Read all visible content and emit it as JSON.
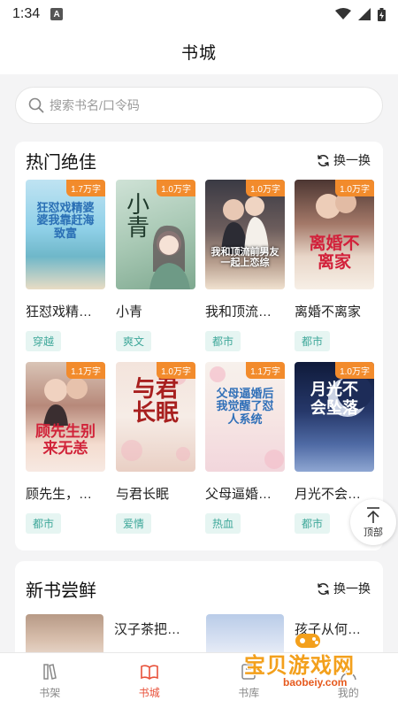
{
  "status": {
    "time": "1:34",
    "notif_letter": "A"
  },
  "header": {
    "title": "书城"
  },
  "search": {
    "placeholder": "搜索书名/口令码"
  },
  "hot": {
    "title": "热门绝佳",
    "refresh_label": "换一换",
    "books": [
      {
        "name": "狂怼戏精…",
        "genre": "穿越",
        "word_count": "1.7万字",
        "cover_text": "狂怼戏精婆婆我靠赶海致富"
      },
      {
        "name": "小青",
        "genre": "爽文",
        "word_count": "1.0万字",
        "cover_text": "小青"
      },
      {
        "name": "我和顶流…",
        "genre": "都市",
        "word_count": "1.0万字",
        "cover_text": "我和顶流前男友一起上恋综"
      },
      {
        "name": "离婚不离家",
        "genre": "都市",
        "word_count": "1.0万字",
        "cover_text": "离婚不离家"
      },
      {
        "name": "顾先生，…",
        "genre": "都市",
        "word_count": "1.1万字",
        "cover_text": "顾先生别来无恙"
      },
      {
        "name": "与君长眠",
        "genre": "爱情",
        "word_count": "1.0万字",
        "cover_text": "与君长眠"
      },
      {
        "name": "父母逼婚…",
        "genre": "热血",
        "word_count": "1.1万字",
        "cover_text": "父母逼婚后我觉醒了怼人系统"
      },
      {
        "name": "月光不会…",
        "genre": "都市",
        "word_count": "1.0万字",
        "cover_text": "月光不会坠落"
      }
    ]
  },
  "back_to_top": {
    "label": "顶部"
  },
  "new_books": {
    "title": "新书尝鲜",
    "refresh_label": "换一换",
    "books": [
      {
        "name": "汉子茶把…"
      },
      {
        "name": "孩子从何…"
      }
    ]
  },
  "tabbar": {
    "items": [
      {
        "label": "书架",
        "icon": "bookshelf-icon"
      },
      {
        "label": "书城",
        "icon": "book-open-icon",
        "active": true
      },
      {
        "label": "书库",
        "icon": "library-icon"
      },
      {
        "label": "我的",
        "icon": "user-icon"
      }
    ]
  },
  "watermark": {
    "text": "宝贝游戏网",
    "url": "baobeiy.com"
  },
  "colors": {
    "accent": "#e8513a",
    "badge": "#f28b2c",
    "genre_text": "#3fa89a",
    "genre_bg": "#e6f5f2"
  }
}
